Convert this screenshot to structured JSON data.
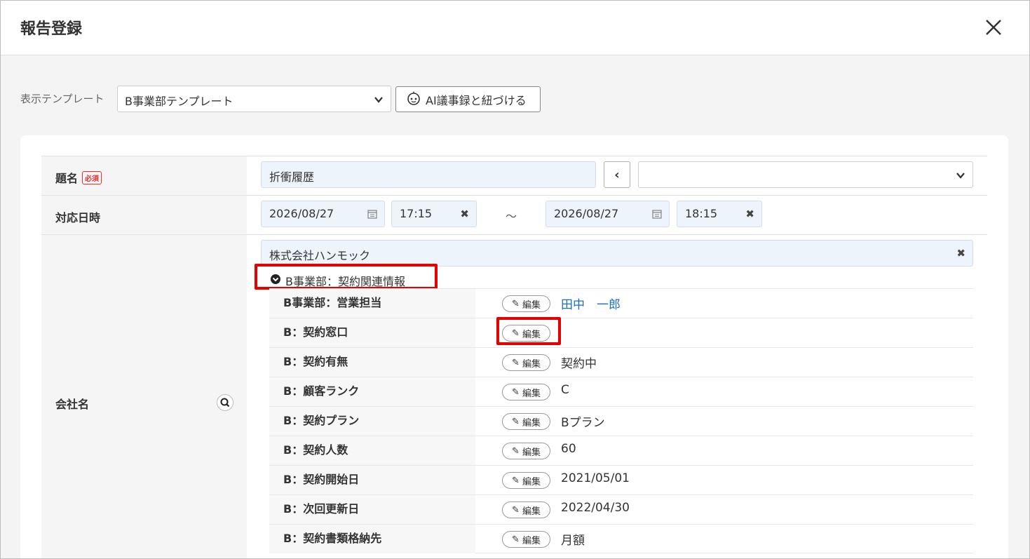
{
  "header": {
    "title": "報告登録"
  },
  "toolbar": {
    "template_label": "表示テンプレート",
    "template_selected": "B事業部テンプレート",
    "ai_button_label": "AI議事録と紐づける"
  },
  "form": {
    "subject": {
      "label": "題名",
      "required_badge": "必須",
      "value": "折衝履歴",
      "prev_symbol": "‹"
    },
    "datetime": {
      "label": "対応日時",
      "start_date": "2026/08/27",
      "start_time": "17:15",
      "separator": "～",
      "end_date": "2026/08/27",
      "end_time": "18:15"
    },
    "company": {
      "label": "会社名",
      "value": "株式会社ハンモック",
      "section_title": "B事業部：契約関連情報",
      "edit_label": "編集",
      "fields": [
        {
          "label": "B事業部：営業担当",
          "value": "田中　一郎"
        },
        {
          "label": "B：契約窓口",
          "value": ""
        },
        {
          "label": "B：契約有無",
          "value": "契約中"
        },
        {
          "label": "B：顧客ランク",
          "value": "C"
        },
        {
          "label": "B：契約プラン",
          "value": "Bプラン"
        },
        {
          "label": "B：契約人数",
          "value": "60"
        },
        {
          "label": "B：契約開始日",
          "value": "2021/05/01"
        },
        {
          "label": "B：次回更新日",
          "value": "2022/04/30"
        },
        {
          "label": "B：契約書類格納先",
          "value": "月額"
        }
      ]
    }
  },
  "colors": {
    "highlight": "#e60000",
    "link": "#1a6fbf",
    "input_bg": "#eef4fb",
    "required": "#e03131"
  }
}
